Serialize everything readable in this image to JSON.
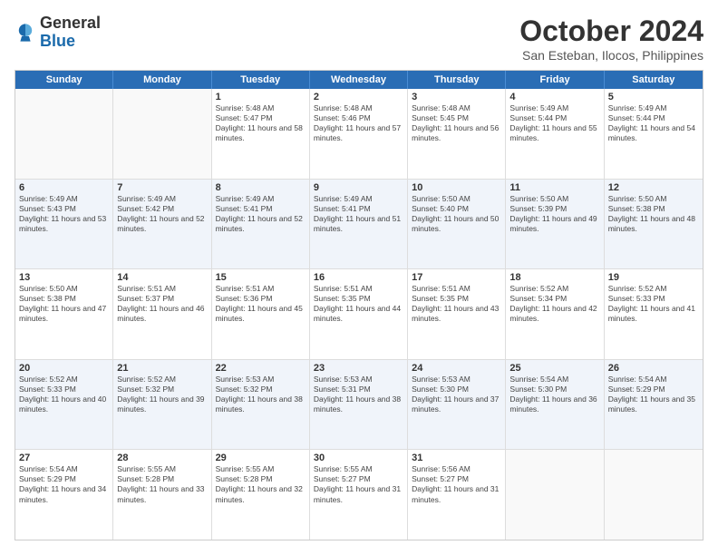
{
  "logo": {
    "line1": "General",
    "line2": "Blue"
  },
  "title": "October 2024",
  "location": "San Esteban, Ilocos, Philippines",
  "weekdays": [
    "Sunday",
    "Monday",
    "Tuesday",
    "Wednesday",
    "Thursday",
    "Friday",
    "Saturday"
  ],
  "rows": [
    [
      {
        "date": "",
        "sunrise": "",
        "sunset": "",
        "daylight": ""
      },
      {
        "date": "",
        "sunrise": "",
        "sunset": "",
        "daylight": ""
      },
      {
        "date": "1",
        "sunrise": "Sunrise: 5:48 AM",
        "sunset": "Sunset: 5:47 PM",
        "daylight": "Daylight: 11 hours and 58 minutes."
      },
      {
        "date": "2",
        "sunrise": "Sunrise: 5:48 AM",
        "sunset": "Sunset: 5:46 PM",
        "daylight": "Daylight: 11 hours and 57 minutes."
      },
      {
        "date": "3",
        "sunrise": "Sunrise: 5:48 AM",
        "sunset": "Sunset: 5:45 PM",
        "daylight": "Daylight: 11 hours and 56 minutes."
      },
      {
        "date": "4",
        "sunrise": "Sunrise: 5:49 AM",
        "sunset": "Sunset: 5:44 PM",
        "daylight": "Daylight: 11 hours and 55 minutes."
      },
      {
        "date": "5",
        "sunrise": "Sunrise: 5:49 AM",
        "sunset": "Sunset: 5:44 PM",
        "daylight": "Daylight: 11 hours and 54 minutes."
      }
    ],
    [
      {
        "date": "6",
        "sunrise": "Sunrise: 5:49 AM",
        "sunset": "Sunset: 5:43 PM",
        "daylight": "Daylight: 11 hours and 53 minutes."
      },
      {
        "date": "7",
        "sunrise": "Sunrise: 5:49 AM",
        "sunset": "Sunset: 5:42 PM",
        "daylight": "Daylight: 11 hours and 52 minutes."
      },
      {
        "date": "8",
        "sunrise": "Sunrise: 5:49 AM",
        "sunset": "Sunset: 5:41 PM",
        "daylight": "Daylight: 11 hours and 52 minutes."
      },
      {
        "date": "9",
        "sunrise": "Sunrise: 5:49 AM",
        "sunset": "Sunset: 5:41 PM",
        "daylight": "Daylight: 11 hours and 51 minutes."
      },
      {
        "date": "10",
        "sunrise": "Sunrise: 5:50 AM",
        "sunset": "Sunset: 5:40 PM",
        "daylight": "Daylight: 11 hours and 50 minutes."
      },
      {
        "date": "11",
        "sunrise": "Sunrise: 5:50 AM",
        "sunset": "Sunset: 5:39 PM",
        "daylight": "Daylight: 11 hours and 49 minutes."
      },
      {
        "date": "12",
        "sunrise": "Sunrise: 5:50 AM",
        "sunset": "Sunset: 5:38 PM",
        "daylight": "Daylight: 11 hours and 48 minutes."
      }
    ],
    [
      {
        "date": "13",
        "sunrise": "Sunrise: 5:50 AM",
        "sunset": "Sunset: 5:38 PM",
        "daylight": "Daylight: 11 hours and 47 minutes."
      },
      {
        "date": "14",
        "sunrise": "Sunrise: 5:51 AM",
        "sunset": "Sunset: 5:37 PM",
        "daylight": "Daylight: 11 hours and 46 minutes."
      },
      {
        "date": "15",
        "sunrise": "Sunrise: 5:51 AM",
        "sunset": "Sunset: 5:36 PM",
        "daylight": "Daylight: 11 hours and 45 minutes."
      },
      {
        "date": "16",
        "sunrise": "Sunrise: 5:51 AM",
        "sunset": "Sunset: 5:35 PM",
        "daylight": "Daylight: 11 hours and 44 minutes."
      },
      {
        "date": "17",
        "sunrise": "Sunrise: 5:51 AM",
        "sunset": "Sunset: 5:35 PM",
        "daylight": "Daylight: 11 hours and 43 minutes."
      },
      {
        "date": "18",
        "sunrise": "Sunrise: 5:52 AM",
        "sunset": "Sunset: 5:34 PM",
        "daylight": "Daylight: 11 hours and 42 minutes."
      },
      {
        "date": "19",
        "sunrise": "Sunrise: 5:52 AM",
        "sunset": "Sunset: 5:33 PM",
        "daylight": "Daylight: 11 hours and 41 minutes."
      }
    ],
    [
      {
        "date": "20",
        "sunrise": "Sunrise: 5:52 AM",
        "sunset": "Sunset: 5:33 PM",
        "daylight": "Daylight: 11 hours and 40 minutes."
      },
      {
        "date": "21",
        "sunrise": "Sunrise: 5:52 AM",
        "sunset": "Sunset: 5:32 PM",
        "daylight": "Daylight: 11 hours and 39 minutes."
      },
      {
        "date": "22",
        "sunrise": "Sunrise: 5:53 AM",
        "sunset": "Sunset: 5:32 PM",
        "daylight": "Daylight: 11 hours and 38 minutes."
      },
      {
        "date": "23",
        "sunrise": "Sunrise: 5:53 AM",
        "sunset": "Sunset: 5:31 PM",
        "daylight": "Daylight: 11 hours and 38 minutes."
      },
      {
        "date": "24",
        "sunrise": "Sunrise: 5:53 AM",
        "sunset": "Sunset: 5:30 PM",
        "daylight": "Daylight: 11 hours and 37 minutes."
      },
      {
        "date": "25",
        "sunrise": "Sunrise: 5:54 AM",
        "sunset": "Sunset: 5:30 PM",
        "daylight": "Daylight: 11 hours and 36 minutes."
      },
      {
        "date": "26",
        "sunrise": "Sunrise: 5:54 AM",
        "sunset": "Sunset: 5:29 PM",
        "daylight": "Daylight: 11 hours and 35 minutes."
      }
    ],
    [
      {
        "date": "27",
        "sunrise": "Sunrise: 5:54 AM",
        "sunset": "Sunset: 5:29 PM",
        "daylight": "Daylight: 11 hours and 34 minutes."
      },
      {
        "date": "28",
        "sunrise": "Sunrise: 5:55 AM",
        "sunset": "Sunset: 5:28 PM",
        "daylight": "Daylight: 11 hours and 33 minutes."
      },
      {
        "date": "29",
        "sunrise": "Sunrise: 5:55 AM",
        "sunset": "Sunset: 5:28 PM",
        "daylight": "Daylight: 11 hours and 32 minutes."
      },
      {
        "date": "30",
        "sunrise": "Sunrise: 5:55 AM",
        "sunset": "Sunset: 5:27 PM",
        "daylight": "Daylight: 11 hours and 31 minutes."
      },
      {
        "date": "31",
        "sunrise": "Sunrise: 5:56 AM",
        "sunset": "Sunset: 5:27 PM",
        "daylight": "Daylight: 11 hours and 31 minutes."
      },
      {
        "date": "",
        "sunrise": "",
        "sunset": "",
        "daylight": ""
      },
      {
        "date": "",
        "sunrise": "",
        "sunset": "",
        "daylight": ""
      }
    ]
  ]
}
